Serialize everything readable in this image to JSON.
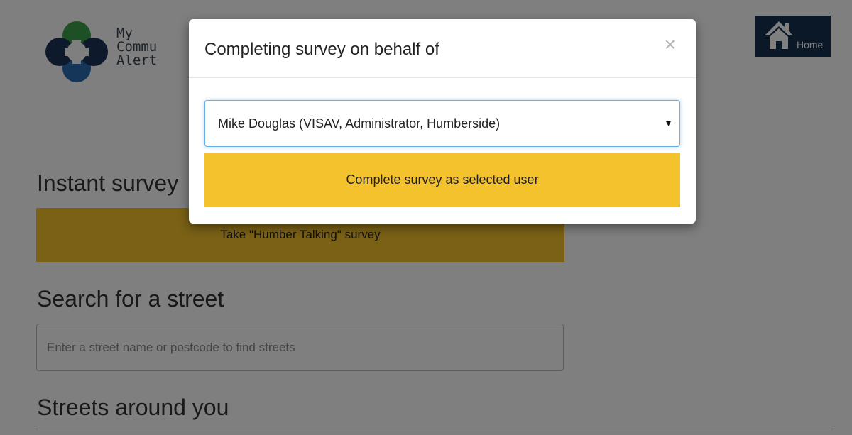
{
  "header": {
    "logo_lines": [
      "My",
      "Commu",
      "Alert"
    ],
    "home_label": "Home"
  },
  "main": {
    "instant_survey_title": "Instant survey",
    "survey_button_label": "Take \"Humber Talking\" survey",
    "search_title": "Search for a street",
    "search_placeholder": "Enter a street name or postcode to find streets",
    "streets_title": "Streets around you"
  },
  "modal": {
    "title": "Completing survey on behalf of",
    "close_glyph": "×",
    "selected_user": "Mike Douglas (VISAV, Administrator, Humberside)",
    "caret_glyph": "▾",
    "complete_label": "Complete survey as selected user"
  },
  "colors": {
    "accent_yellow": "#f4c22c",
    "home_bg": "#16304f",
    "focus_border": "#66afe9",
    "logo_green": "#3aa14a",
    "logo_blue": "#2b6cb0",
    "logo_navy": "#1d3557"
  }
}
